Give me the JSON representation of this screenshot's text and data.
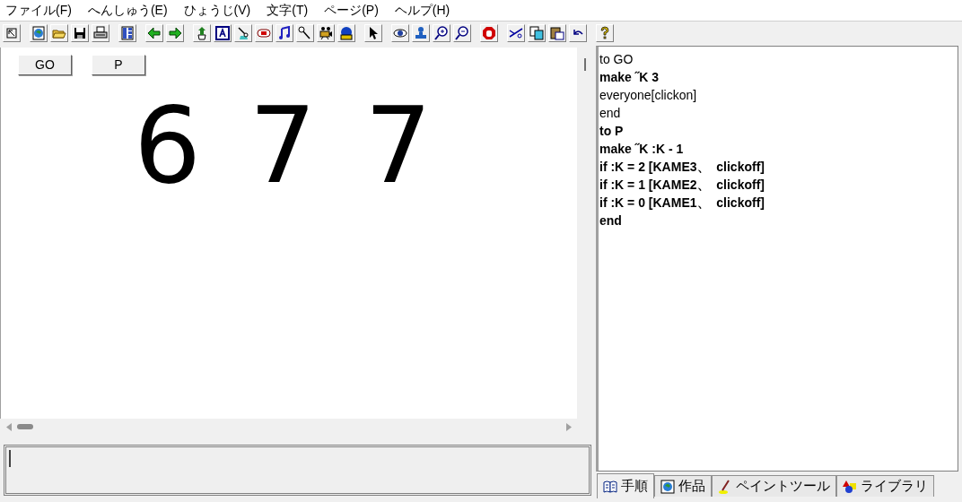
{
  "menu": [
    "ファイル(F)",
    "へんしゅう(E)",
    "ひょうじ(V)",
    "文字(T)",
    "ページ(P)",
    "ヘルプ(H)"
  ],
  "stage": {
    "buttons": [
      "GO",
      "P"
    ],
    "drawing_text": "6 7 7"
  },
  "procedures": [
    {
      "text": "to GO",
      "bold": false
    },
    {
      "text": "make ˝K 3",
      "bold": true
    },
    {
      "text": "everyone[clickon]",
      "bold": false
    },
    {
      "text": "end",
      "bold": false
    },
    {
      "text": "to P",
      "bold": true
    },
    {
      "text": "make ˝K :K - 1",
      "bold": true
    },
    {
      "text": "if :K = 2 [KAME3、  clickoff]",
      "bold": true
    },
    {
      "text": "if :K = 1 [KAME2、  clickoff]",
      "bold": true
    },
    {
      "text": "if :K = 0 [KAME1、  clickoff]",
      "bold": true
    },
    {
      "text": "end",
      "bold": true
    }
  ],
  "tabs": [
    {
      "label": "手順",
      "kind": "book",
      "selected": true
    },
    {
      "label": "作品",
      "kind": "globe",
      "selected": false
    },
    {
      "label": "ペイントツール",
      "kind": "brush",
      "selected": false
    },
    {
      "label": "ライブラリ",
      "kind": "shapes",
      "selected": false
    }
  ]
}
